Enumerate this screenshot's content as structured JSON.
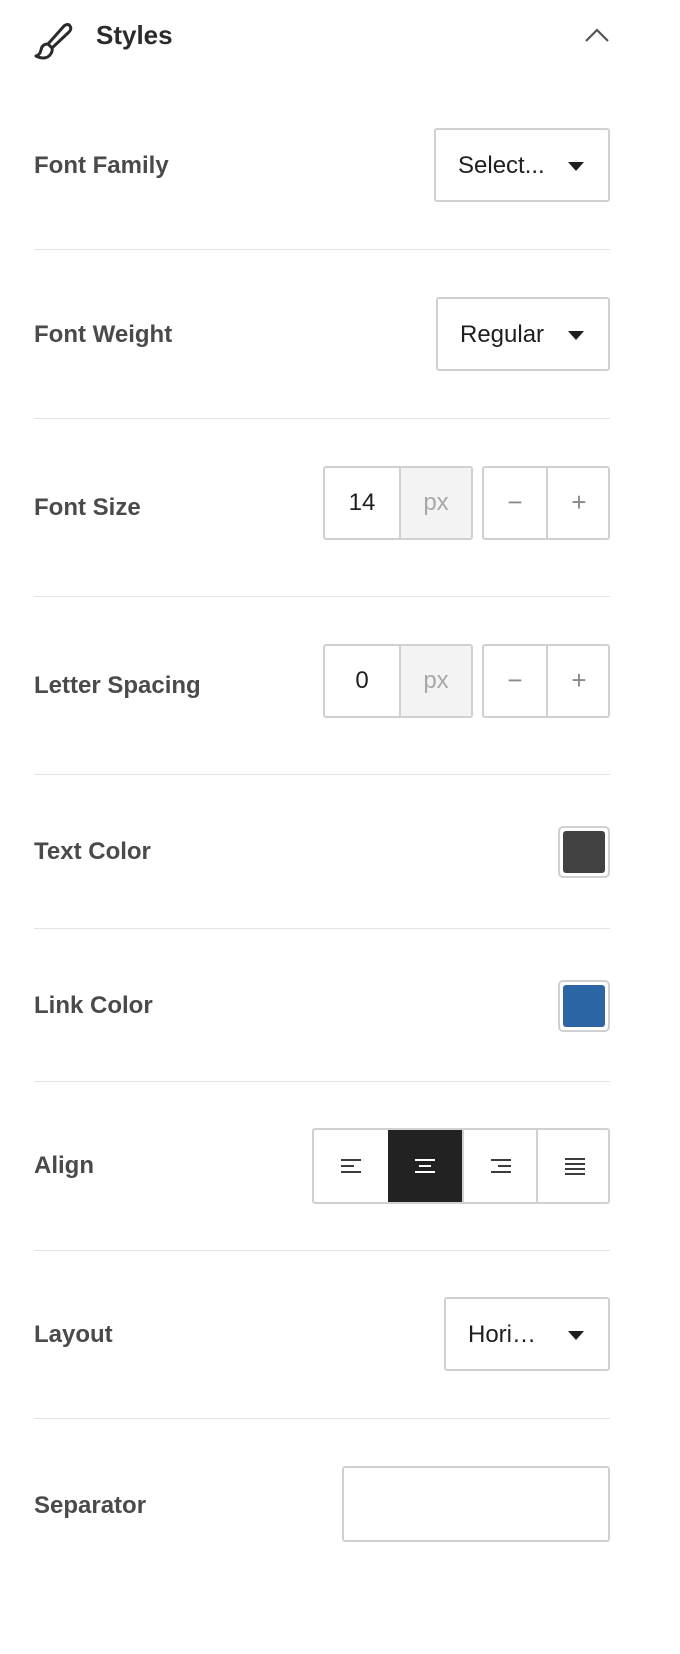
{
  "panel": {
    "title": "Styles",
    "header_icon": "paintbrush-icon",
    "collapse_icon": "chevron-up-icon"
  },
  "font_family": {
    "label": "Font Family",
    "value": "Select..."
  },
  "font_weight": {
    "label": "Font Weight",
    "value": "Regular"
  },
  "font_size": {
    "label": "Font Size",
    "value": "14",
    "unit": "px",
    "minus": "−",
    "plus": "+"
  },
  "letter_spacing": {
    "label": "Letter Spacing",
    "value": "0",
    "unit": "px",
    "minus": "−",
    "plus": "+"
  },
  "text_color": {
    "label": "Text Color",
    "color": "#424242"
  },
  "link_color": {
    "label": "Link Color",
    "color": "#2b65a4"
  },
  "align": {
    "label": "Align",
    "options": [
      "left",
      "center",
      "right",
      "justify"
    ],
    "selected": "center"
  },
  "layout": {
    "label": "Layout",
    "value": "Hori…"
  },
  "separator": {
    "label": "Separator",
    "value": ""
  }
}
